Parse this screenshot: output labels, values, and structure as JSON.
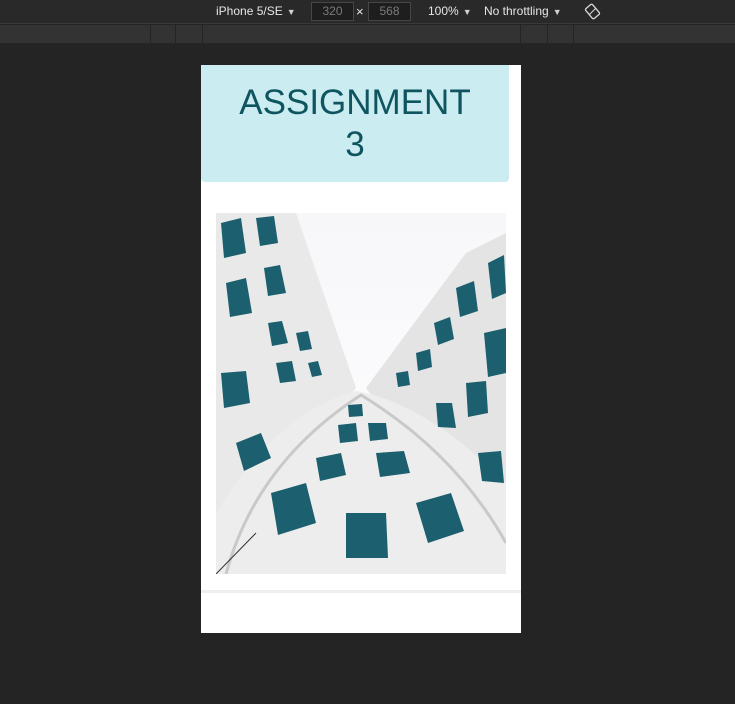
{
  "toolbar": {
    "device": "iPhone 5/SE",
    "width": "320",
    "height": "568",
    "times": "×",
    "zoom": "100%",
    "throttling": "No throttling",
    "dropdown_arrow": "▼",
    "rotate_icon": "rotate-icon"
  },
  "page": {
    "title": "ASSIGNMENT 3",
    "header_color": "#cbecf1",
    "title_color": "#0e5560",
    "image_icon": "building-photo"
  }
}
